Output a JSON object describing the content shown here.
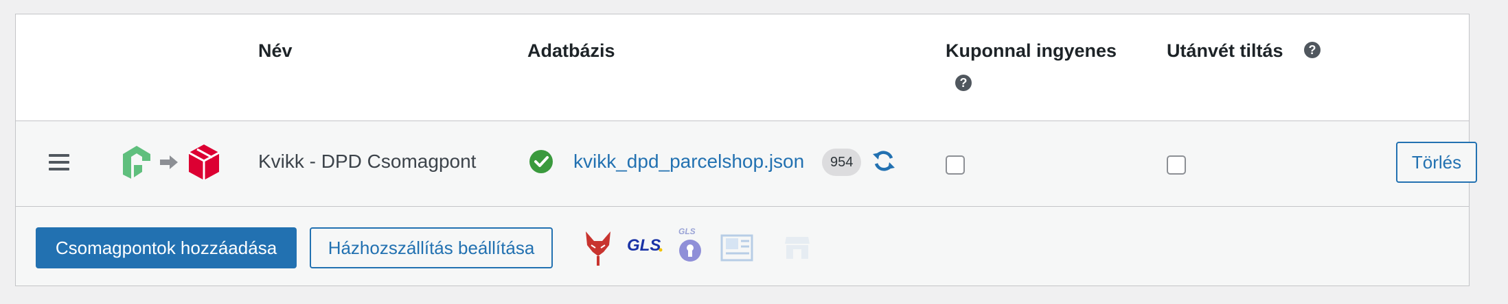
{
  "table": {
    "headers": {
      "name": "Név",
      "database": "Adatbázis",
      "coupon_free": "Kuponnal ingyenes",
      "cod_disable": "Utánvét tiltás"
    },
    "rows": [
      {
        "name": "Kvikk - DPD Csomagpont",
        "database_file": "kvikk_dpd_parcelshop.json",
        "count": "954",
        "coupon_free_checked": false,
        "cod_disable_checked": false,
        "delete_label": "Törlés"
      }
    ]
  },
  "footer": {
    "add_points_label": "Csomagpontok hozzáadása",
    "home_delivery_label": "Házhozszállítás beállítása",
    "provider_icons": [
      "foxpost-icon",
      "gls-icon",
      "gls-locker-icon",
      "packeta-icon",
      "store-icon"
    ]
  },
  "help_mark": "?",
  "colors": {
    "accent": "#2271b1",
    "success": "#3a9a3d",
    "kvikk_green": "#5fbf7d",
    "dpd_red": "#dc0032",
    "fox_red": "#c8342f",
    "gls_blue": "#1a33a6"
  }
}
